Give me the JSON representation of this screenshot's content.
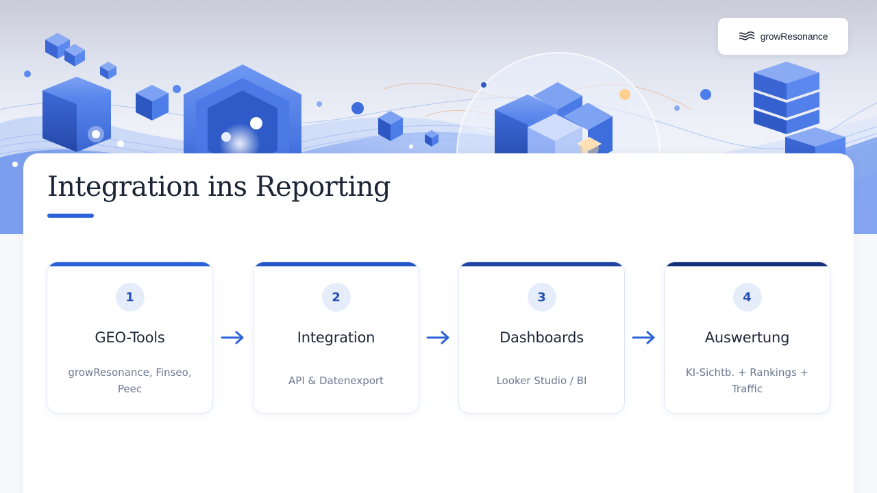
{
  "brand": {
    "name": "growResonance",
    "accent": "#2b62d9",
    "logo_icon": "wave-lines-icon"
  },
  "page": {
    "title": "Integration ins Reporting"
  },
  "steps": [
    {
      "number": "1",
      "title": "GEO-Tools",
      "description": "growResonance, Finseo, Peec",
      "bar_color": "#2b62d9"
    },
    {
      "number": "2",
      "title": "Integration",
      "description": "API & Datenexport",
      "bar_color": "#2556c8"
    },
    {
      "number": "3",
      "title": "Dashboards",
      "description": "Looker Studio / BI",
      "bar_color": "#1e43a3"
    },
    {
      "number": "4",
      "title": "Auswertung",
      "description": "KI-Sichtb. + Rankings + Traffic",
      "bar_color": "#15307a"
    }
  ],
  "connector_icon": "arrow-right-icon",
  "hero_illustration": "isometric-cubes-network-illustration"
}
